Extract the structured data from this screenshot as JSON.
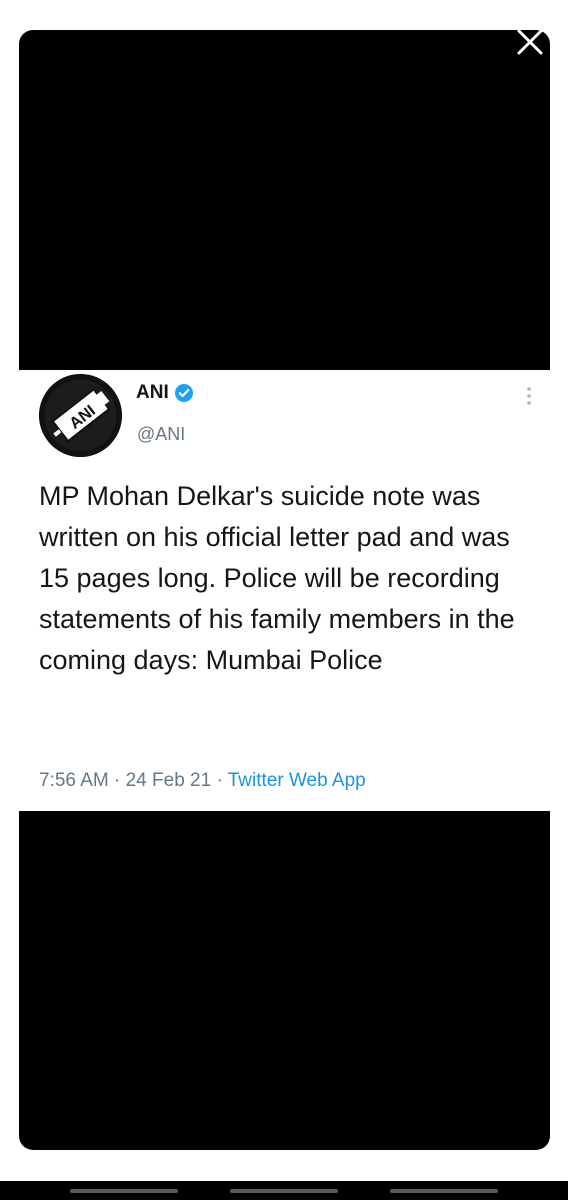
{
  "viewer": {
    "close_icon": "close-icon"
  },
  "tweet": {
    "author_name": "ANI",
    "handle": "@ANI",
    "verified_icon": "verified-badge-icon",
    "avatar_logo_text": "ANI",
    "text": "MP Mohan Delkar's suicide note was written on his official letter pad and was 15 pages long. Police will be recording statements of his family members in the coming days: Mumbai Police",
    "time": "7:56 AM",
    "date": "24 Feb 21",
    "separator": "·",
    "source": "Twitter Web App",
    "more_icon": "more-vertical-icon"
  },
  "colors": {
    "background": "#000000",
    "card": "#ffffff",
    "text": "#14171a",
    "muted": "#657786",
    "link": "#1b95e0",
    "verified": "#1da1f2"
  }
}
